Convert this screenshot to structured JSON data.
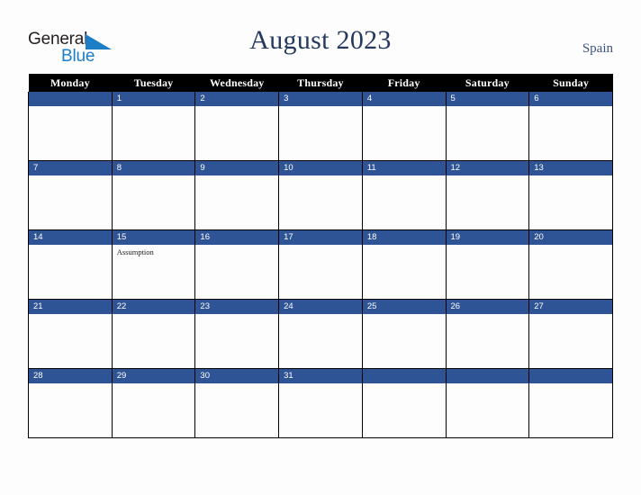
{
  "brand": {
    "name_part1": "General",
    "name_part2": "Blue",
    "triangle_color": "#1c7ec7",
    "text_color": "#231f20",
    "blue_color": "#1c7ec7"
  },
  "header": {
    "title": "August 2023",
    "country": "Spain",
    "title_color": "#23395d",
    "country_color": "#3c5480"
  },
  "calendar": {
    "month": "August",
    "year": "2023",
    "header_bg": "#000000",
    "header_fg": "#ffffff",
    "daynum_bg": "#2f5496",
    "daynum_fg": "#ffffff",
    "cell_bg": "#fdfdfd",
    "border_color": "#000000",
    "weekday_headers": [
      "Monday",
      "Tuesday",
      "Wednesday",
      "Thursday",
      "Friday",
      "Saturday",
      "Sunday"
    ],
    "weeks": [
      [
        {
          "day": "",
          "event": ""
        },
        {
          "day": "1",
          "event": ""
        },
        {
          "day": "2",
          "event": ""
        },
        {
          "day": "3",
          "event": ""
        },
        {
          "day": "4",
          "event": ""
        },
        {
          "day": "5",
          "event": ""
        },
        {
          "day": "6",
          "event": ""
        }
      ],
      [
        {
          "day": "7",
          "event": ""
        },
        {
          "day": "8",
          "event": ""
        },
        {
          "day": "9",
          "event": ""
        },
        {
          "day": "10",
          "event": ""
        },
        {
          "day": "11",
          "event": ""
        },
        {
          "day": "12",
          "event": ""
        },
        {
          "day": "13",
          "event": ""
        }
      ],
      [
        {
          "day": "14",
          "event": ""
        },
        {
          "day": "15",
          "event": "Assumption"
        },
        {
          "day": "16",
          "event": ""
        },
        {
          "day": "17",
          "event": ""
        },
        {
          "day": "18",
          "event": ""
        },
        {
          "day": "19",
          "event": ""
        },
        {
          "day": "20",
          "event": ""
        }
      ],
      [
        {
          "day": "21",
          "event": ""
        },
        {
          "day": "22",
          "event": ""
        },
        {
          "day": "23",
          "event": ""
        },
        {
          "day": "24",
          "event": ""
        },
        {
          "day": "25",
          "event": ""
        },
        {
          "day": "26",
          "event": ""
        },
        {
          "day": "27",
          "event": ""
        }
      ],
      [
        {
          "day": "28",
          "event": ""
        },
        {
          "day": "29",
          "event": ""
        },
        {
          "day": "30",
          "event": ""
        },
        {
          "day": "31",
          "event": ""
        },
        {
          "day": "",
          "event": ""
        },
        {
          "day": "",
          "event": ""
        },
        {
          "day": "",
          "event": ""
        }
      ]
    ]
  }
}
